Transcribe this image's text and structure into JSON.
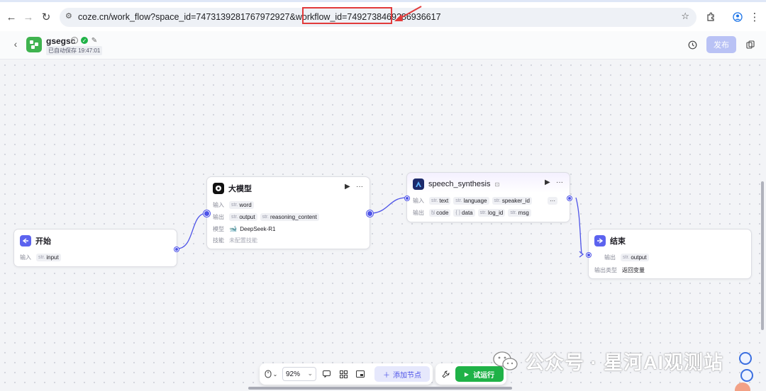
{
  "browser": {
    "url": "coze.cn/work_flow?space_id=7473139281767972927&workflow_id=7492738469286936617"
  },
  "header": {
    "app_name": "gsegsc",
    "save_status": "已自动保存 19:47:01",
    "publish_label": "发布"
  },
  "nodes": {
    "start": {
      "title": "开始",
      "input_label": "输入",
      "input_type": "str.",
      "input_name": "input"
    },
    "llm": {
      "title": "大模型",
      "input_label": "输入",
      "input_type": "str.",
      "input_name": "word",
      "output_label": "输出",
      "output_type": "str.",
      "output_name": "output",
      "output2_type": "str.",
      "output2_name": "reasoning_content",
      "model_label": "模型",
      "model_name": "DeepSeek-R1",
      "skill_label": "技能",
      "skill_value": "未配置技能"
    },
    "speech": {
      "title": "speech_synthesis",
      "input_label": "输入",
      "inputs": [
        {
          "type": "str.",
          "name": "text"
        },
        {
          "type": "str.",
          "name": "language"
        },
        {
          "type": "str.",
          "name": "speaker_id"
        }
      ],
      "output_label": "输出",
      "outputs": [
        {
          "type": "N̲",
          "name": "code"
        },
        {
          "type": "{ }",
          "name": "data"
        },
        {
          "type": "str.",
          "name": "log_id"
        },
        {
          "type": "str.",
          "name": "msg"
        }
      ],
      "more_label": "···"
    },
    "end": {
      "title": "结束",
      "output_label": "输出",
      "output_type": "str.",
      "output_name": "output",
      "output_kind_label": "输出类型",
      "output_kind_value": "返回变量"
    }
  },
  "toolbar": {
    "zoom": "92%",
    "add_node_label": "添加节点",
    "test_run_label": "试运行"
  },
  "watermark": {
    "text": "公众号 · 星河AI观测站"
  },
  "colors": {
    "accent": "#4d53e8",
    "run_green": "#1fb247",
    "brand_green": "#3fb34f",
    "highlight_red": "#e23b3b"
  }
}
